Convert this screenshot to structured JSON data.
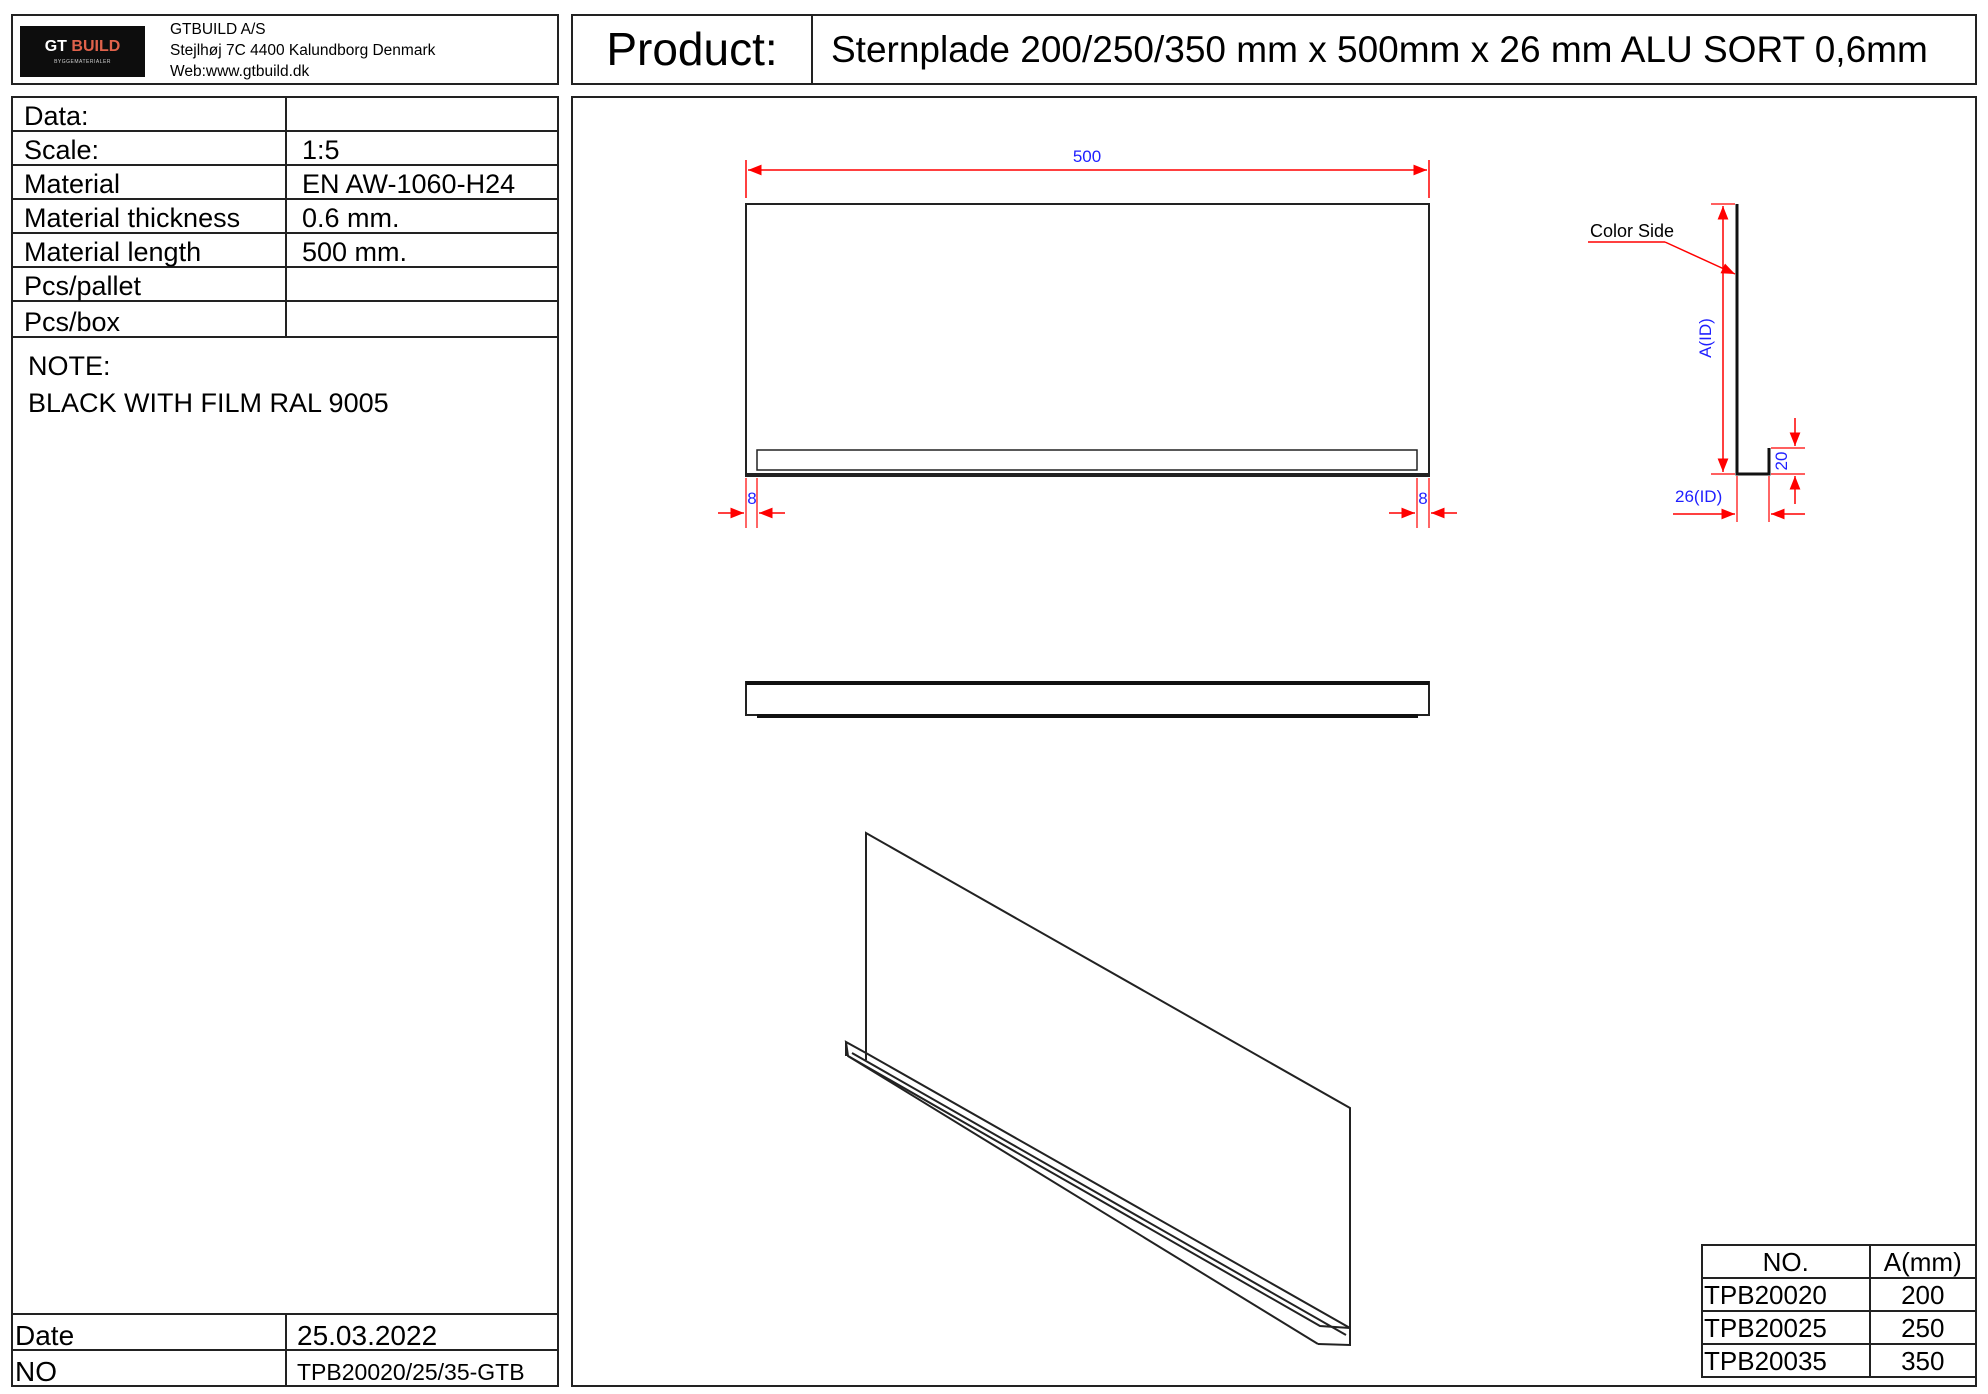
{
  "company": {
    "logo_text": "GT BUILD",
    "logo_text_a": "GT",
    "logo_text_b": "BUILD",
    "logo_subtext": "BYGGEMATERIALER",
    "name": "GTBUILD A/S",
    "address": "Stejlhøj 7C 4400 Kalundborg Denmark",
    "web": "Web:www.gtbuild.dk"
  },
  "product": {
    "label": "Product:",
    "name": "Sternplade 200/250/350 mm x 500mm x 26 mm ALU SORT 0,6mm"
  },
  "data_table": [
    {
      "key": "Data:",
      "value": ""
    },
    {
      "key": "Scale:",
      "value": "1:5"
    },
    {
      "key": "Material",
      "value": "EN AW-1060-H24"
    },
    {
      "key": "Material thickness",
      "value": "0.6 mm."
    },
    {
      "key": "Material length",
      "value": "500 mm."
    },
    {
      "key": "Pcs/pallet",
      "value": ""
    },
    {
      "key": "Pcs/box",
      "value": ""
    }
  ],
  "note": {
    "title": "NOTE:",
    "text": "BLACK WITH FILM RAL 9005"
  },
  "footer": {
    "date_label": "Date",
    "date_value": "25.03.2022",
    "no_label": "NO",
    "no_value": "TPB20020/25/35-GTB"
  },
  "drawing": {
    "dim_length": "500",
    "dim_left_end": "8",
    "dim_right_end": "8",
    "color_side_label": "Color Side",
    "dim_height": "A(ID)",
    "dim_lip": "20",
    "dim_depth": "26(ID)",
    "dim_color": "#1f1fff",
    "dim_line_color": "#ff0000"
  },
  "variants": {
    "headers": [
      "NO.",
      "A(mm)"
    ],
    "rows": [
      {
        "no": "TPB20020",
        "a": "200"
      },
      {
        "no": "TPB20025",
        "a": "250"
      },
      {
        "no": "TPB20035",
        "a": "350"
      }
    ]
  }
}
